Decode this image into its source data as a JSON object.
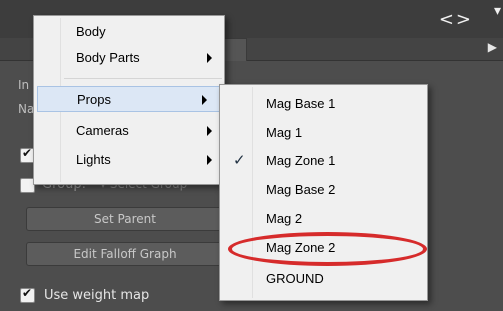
{
  "window": {
    "nav_arrows": "<>",
    "corner_glyph": "▾"
  },
  "panel": {
    "side_labels": [
      "In",
      "Na"
    ],
    "group_label": "Group:",
    "group_select": "Select Group",
    "set_parent_label": "Set Parent",
    "edit_falloff_label": "Edit Falloff Graph",
    "use_weight_map_label": "Use weight map",
    "use_weight_map_checked": true
  },
  "menu": {
    "items": [
      {
        "label": "Body",
        "submenu": false
      },
      {
        "label": "Body Parts",
        "submenu": true
      },
      {
        "label": "Props",
        "submenu": true,
        "highlighted": true
      },
      {
        "label": "Cameras",
        "submenu": true
      },
      {
        "label": "Lights",
        "submenu": true
      }
    ]
  },
  "submenu": {
    "items": [
      {
        "label": "Mag Base 1"
      },
      {
        "label": "Mag 1"
      },
      {
        "label": "Mag Zone 1",
        "checked": true
      },
      {
        "label": "Mag Base 2"
      },
      {
        "label": "Mag 2"
      },
      {
        "label": "Mag Zone 2",
        "circled": true
      },
      {
        "label": "GROUND"
      }
    ],
    "check_glyph": "✓"
  },
  "colors": {
    "annotation": "#d62b2b",
    "highlight": "#dce7f5"
  }
}
